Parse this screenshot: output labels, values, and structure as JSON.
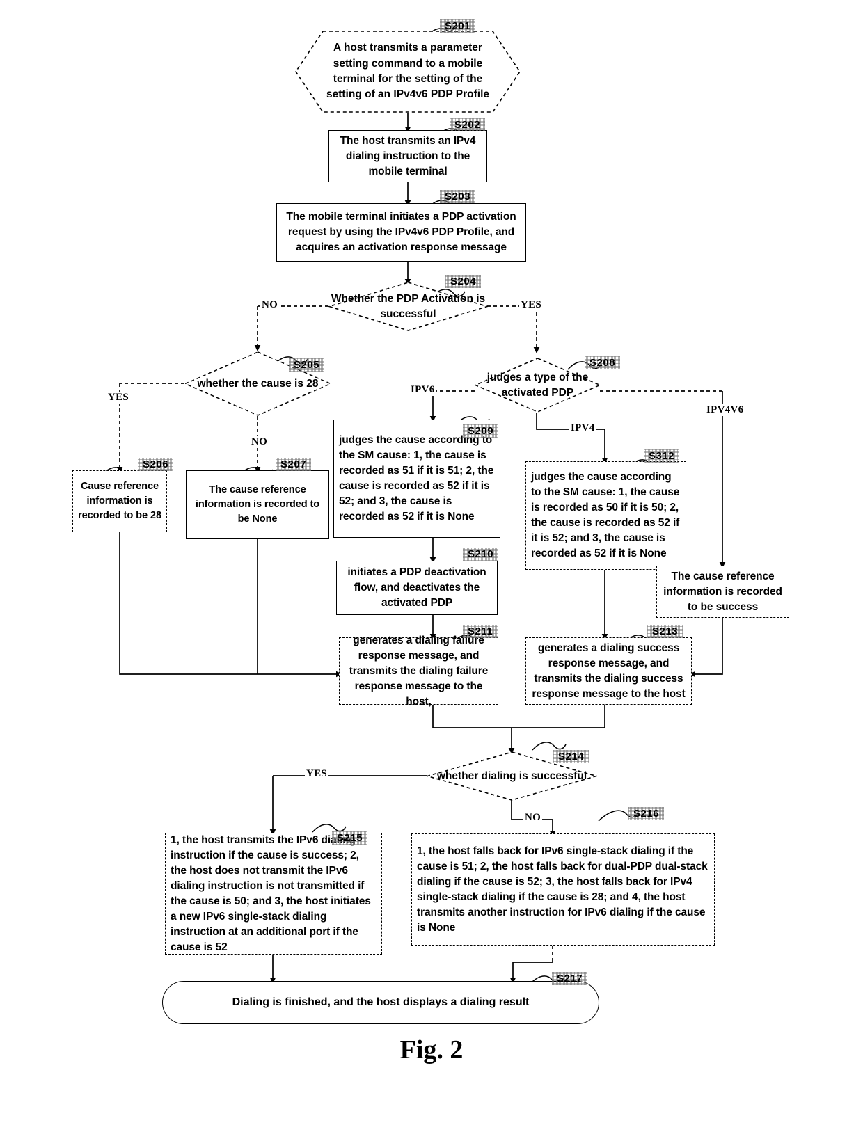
{
  "figure": {
    "caption": "Fig. 2"
  },
  "nodes": {
    "s201": {
      "tag": "S201",
      "shape": "hexagon",
      "text": "A host transmits a parameter setting command to a mobile terminal for the setting of the setting of an IPv4v6 PDP Profile"
    },
    "s202": {
      "tag": "S202",
      "shape": "process",
      "text": "The host transmits an IPv4 dialing instruction to the mobile terminal"
    },
    "s203": {
      "tag": "S203",
      "shape": "process",
      "text": "The mobile terminal initiates a PDP activation request by using the IPv4v6 PDP Profile, and acquires an activation response message"
    },
    "s204": {
      "tag": "S204",
      "shape": "decision",
      "text": "Whether the PDP Activation is successful"
    },
    "s205": {
      "tag": "S205",
      "shape": "decision",
      "text": "whether the cause is 28"
    },
    "s206": {
      "tag": "S206",
      "shape": "process",
      "text": "Cause reference information is recorded to be 28"
    },
    "s207": {
      "tag": "S207",
      "shape": "process",
      "text": "The cause reference information is recorded to be None"
    },
    "s208": {
      "tag": "S208",
      "shape": "decision",
      "text": "judges a type of the activated PDP"
    },
    "s209": {
      "tag": "S209",
      "shape": "process",
      "text": "judges the cause according to the SM cause: 1, the cause is recorded as 51 if it is 51; 2, the cause is recorded as 52 if it is 52; and 3, the cause is recorded as 52 if it is None"
    },
    "s210": {
      "tag": "S210",
      "shape": "process",
      "text": "initiates a PDP deactivation flow, and deactivates the activated PDP"
    },
    "s211": {
      "tag": "S211",
      "shape": "process",
      "text": "generates a dialing failure response message, and transmits the dialing failure response message to the host,"
    },
    "s212": {
      "tag": "S312",
      "shape": "process",
      "text": "judges the cause according to the SM cause: 1, the cause is recorded as 50 if it is 50; 2, the cause is recorded as 52 if it is 52; and 3, the cause is recorded as 52 if it is None"
    },
    "s212b": {
      "tag": "",
      "shape": "process",
      "text": "The cause reference information is recorded to be success"
    },
    "s213": {
      "tag": "S213",
      "shape": "process",
      "text": "generates a dialing success response message, and transmits the dialing success response message to the host"
    },
    "s214": {
      "tag": "S214",
      "shape": "decision",
      "text": "whether dialing is successful"
    },
    "s215": {
      "tag": "S215",
      "shape": "process",
      "text": "1, the host transmits the IPv6 dialing instruction if the cause is success; 2, the host does not transmit the IPv6 dialing instruction is not transmitted if the cause is 50; and 3, the host initiates a new IPv6 single-stack dialing instruction at an additional port if the cause is 52"
    },
    "s216": {
      "tag": "S216",
      "shape": "process",
      "text": "1, the host falls back for IPv6 single-stack dialing if the cause is 51; 2, the host falls back for dual-PDP dual-stack dialing if the cause is 52; 3, the host falls back for IPv4 single-stack dialing if the cause is 28; and 4, the host transmits another instruction for IPv6 dialing if the cause is None"
    },
    "s217": {
      "tag": "S217",
      "shape": "terminator",
      "text": "Dialing is finished, and the host displays a dialing result"
    }
  },
  "edge_labels": {
    "s204_no": "NO",
    "s204_yes": "YES",
    "s205_yes": "YES",
    "s205_no": "NO",
    "s208_ipv6": "IPV6",
    "s208_ipv4": "IPV4",
    "s208_ipv4v6": "IPV4V6",
    "s214_yes": "YES",
    "s214_no": "NO"
  },
  "colors": {
    "stroke": "#000000",
    "background": "#ffffff"
  }
}
